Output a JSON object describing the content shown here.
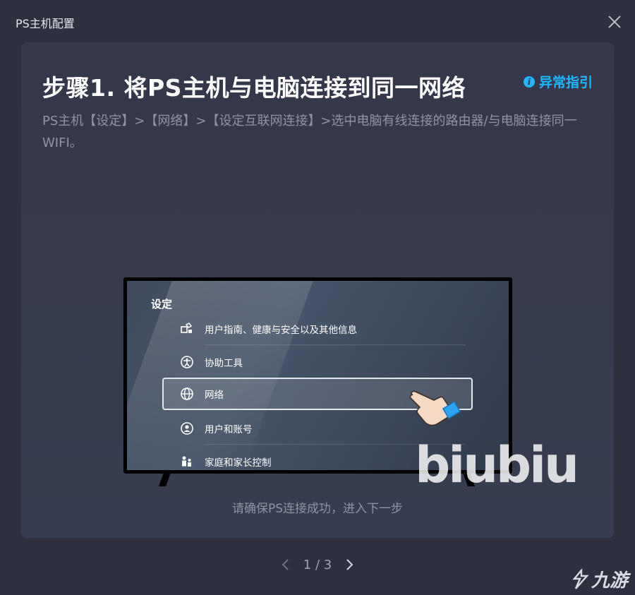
{
  "window": {
    "title": "PS主机配置"
  },
  "step": {
    "title": "步骤1. 将PS主机与电脑连接到同一网络",
    "guide_link": "异常指引",
    "description": "PS主机【设定】>【网络】>【设定互联网连接】>选中电脑有线连接的路由器/与电脑连接同一WIFI。"
  },
  "tv": {
    "settings_title": "设定",
    "menu": [
      {
        "label": "用户指南、健康与安全以及其他信息",
        "icon": "user-guide-icon"
      },
      {
        "label": "协助工具",
        "icon": "accessibility-icon"
      },
      {
        "label": "网络",
        "icon": "globe-icon",
        "selected": true
      },
      {
        "label": "用户和账号",
        "icon": "user-account-icon"
      },
      {
        "label": "家庭和家长控制",
        "icon": "family-icon"
      }
    ]
  },
  "confirm_text": "请确保PS连接成功，进入下一步",
  "pager": {
    "current": 1,
    "total": 3,
    "text": "1 / 3"
  },
  "watermarks": {
    "biubiu": "biubiu",
    "nine": "九游"
  },
  "colors": {
    "accent": "#1fb8ff",
    "background": "#2e3040",
    "card": "#363a4d",
    "muted_text": "#8f93a6"
  }
}
